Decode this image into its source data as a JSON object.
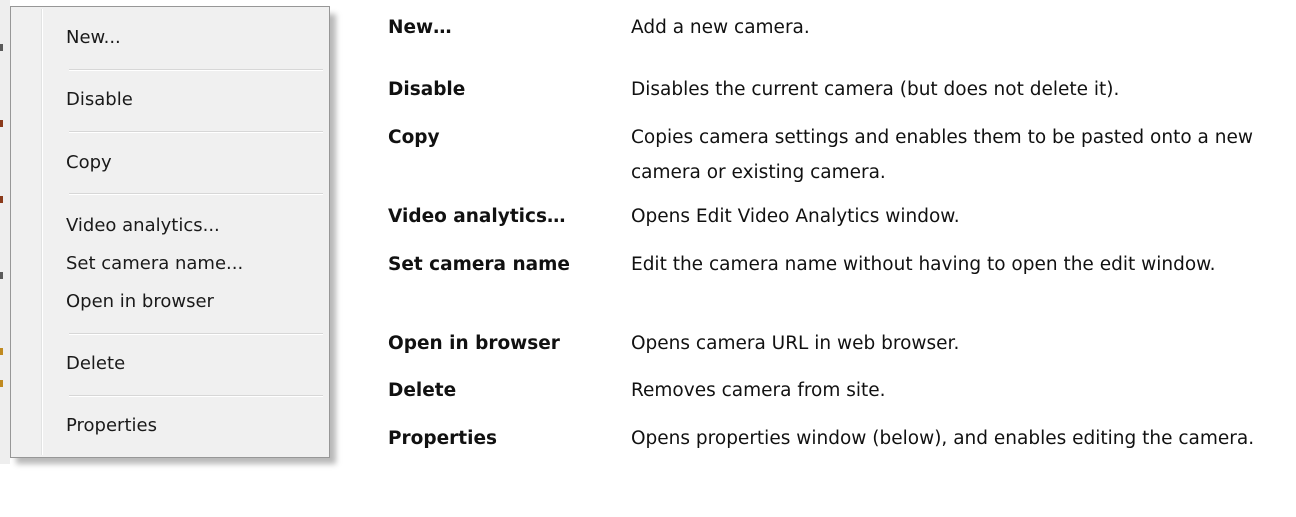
{
  "colors": {
    "menu_background": "#f0f0f0",
    "menu_border": "#979797",
    "text": "#111111"
  },
  "context_menu": {
    "items": [
      {
        "label": "New..."
      },
      {
        "label": "Disable"
      },
      {
        "label": "Copy"
      },
      {
        "label": "Video analytics..."
      },
      {
        "label": "Set camera name..."
      },
      {
        "label": "Open in browser"
      },
      {
        "label": "Delete"
      },
      {
        "label": "Properties"
      }
    ]
  },
  "descriptions": [
    {
      "term": "New…",
      "definition": "Add a new camera."
    },
    {
      "term": "Disable",
      "definition": "Disables the current camera (but does not delete it)."
    },
    {
      "term": "Copy",
      "definition": "Copies camera settings and enables them to be pasted onto a new camera or existing camera."
    },
    {
      "term": "Video analytics…",
      "definition": "Opens Edit Video Analytics window."
    },
    {
      "term": "Set camera name",
      "definition": "Edit the camera name without having to open the edit window."
    },
    {
      "term": "Open in browser",
      "definition": "Opens camera URL in web browser."
    },
    {
      "term": "Delete",
      "definition": "Removes camera from site."
    },
    {
      "term": "Properties",
      "definition": "Opens properties window (below), and enables editing the camera."
    }
  ]
}
